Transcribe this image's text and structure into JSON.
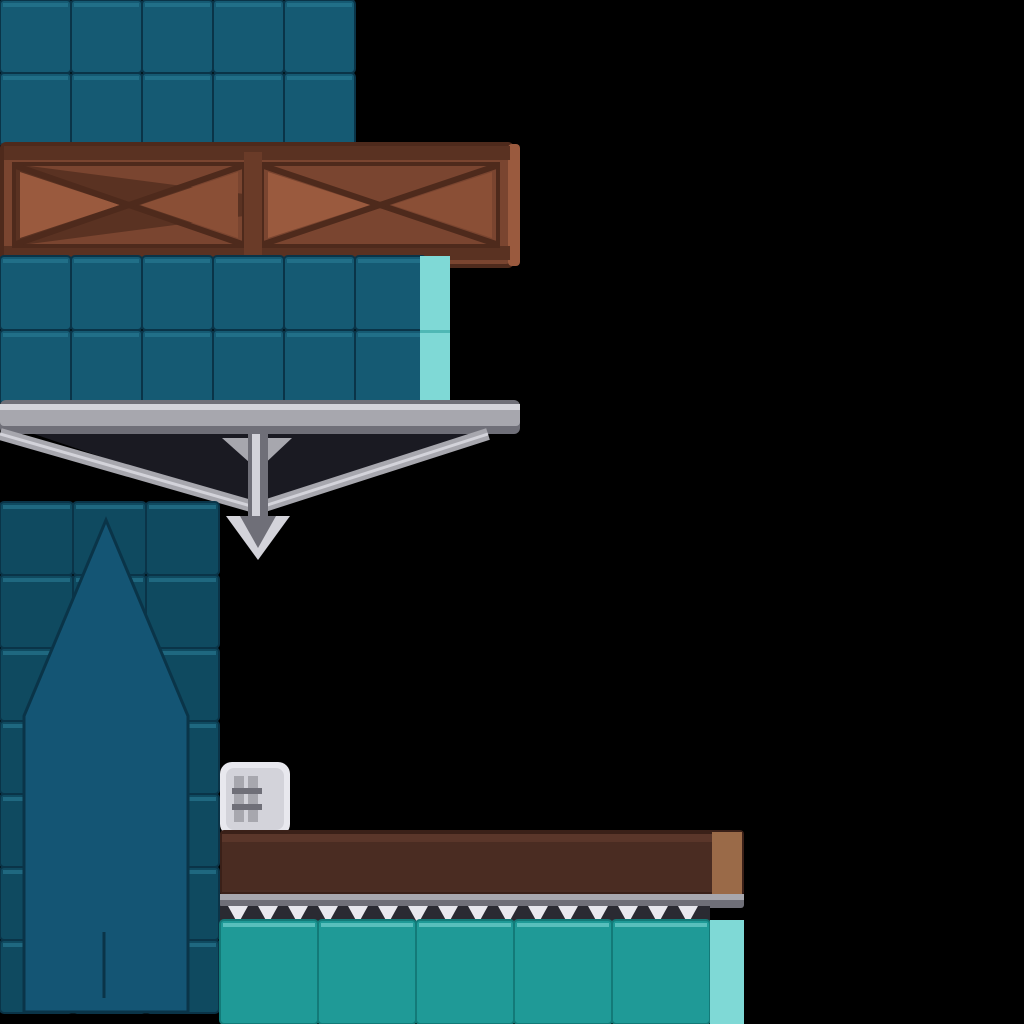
{
  "sheet": {
    "type": "sprite-atlas",
    "background": "#000000"
  },
  "palette": {
    "stone_dark": "#0f4a60",
    "stone_mid": "#155a73",
    "stone_light": "#2a7d96",
    "stone_edge": "#0a3448",
    "ice_main": "#1f9a97",
    "ice_light": "#7fd9d6",
    "ice_edge": "#137a78",
    "wood_main": "#7a4530",
    "wood_dark": "#4e2a1c",
    "wood_light": "#9a5a3e",
    "dark_wood": "#4a2c22",
    "metal_main": "#a7a7ae",
    "metal_dark": "#6f6f78",
    "metal_light": "#d3d3da",
    "spike_white": "#e8e8ee"
  },
  "sprites": [
    {
      "name": "stone-block-top",
      "material": "stone"
    },
    {
      "name": "wooden-truss-plank",
      "material": "wood"
    },
    {
      "name": "stone-block-middle",
      "material": "stone"
    },
    {
      "name": "metal-truss-bridge",
      "material": "metal"
    },
    {
      "name": "stone-pillar-arch",
      "material": "stone"
    },
    {
      "name": "metal-bracket",
      "material": "metal"
    },
    {
      "name": "spiked-wood-platform",
      "material": "wood"
    },
    {
      "name": "ice-block-row",
      "material": "ice"
    }
  ]
}
